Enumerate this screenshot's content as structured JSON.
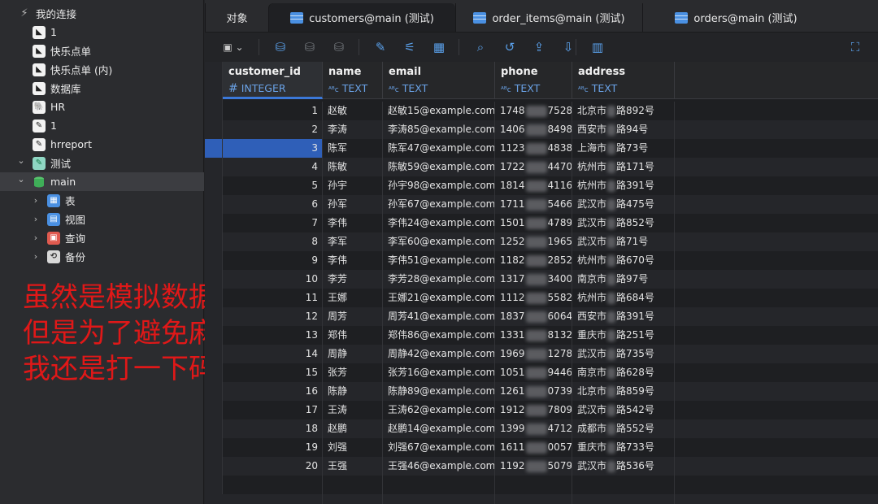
{
  "sidebar": {
    "items": [
      {
        "label": "我的连接",
        "icon": "connections-icon",
        "depth": 0
      },
      {
        "label": "1",
        "icon": "connection-icon",
        "depth": 1
      },
      {
        "label": "快乐点单",
        "icon": "connection-icon",
        "depth": 1
      },
      {
        "label": "快乐点单 (内)",
        "icon": "connection-icon",
        "depth": 1
      },
      {
        "label": "数据库",
        "icon": "connection-icon",
        "depth": 1
      },
      {
        "label": "HR",
        "icon": "postgres-icon",
        "depth": 1
      },
      {
        "label": "1",
        "icon": "feather-icon",
        "depth": 1
      },
      {
        "label": "hrreport",
        "icon": "feather-icon",
        "depth": 1
      },
      {
        "label": "测试",
        "icon": "sqlite-icon",
        "depth": 1,
        "expanded": true
      },
      {
        "label": "main",
        "icon": "database-icon",
        "depth": 2,
        "expanded": true,
        "selected": true
      },
      {
        "label": "表",
        "icon": "table-icon",
        "depth": 3
      },
      {
        "label": "视图",
        "icon": "view-icon",
        "depth": 3
      },
      {
        "label": "查询",
        "icon": "query-icon",
        "depth": 3
      },
      {
        "label": "备份",
        "icon": "backup-icon",
        "depth": 3
      }
    ]
  },
  "annotation": {
    "lines": [
      "虽然是模拟数据，",
      "但是为了避免麻烦，",
      "我还是打一下码"
    ],
    "color": "#e01818"
  },
  "tabs": [
    {
      "label": "对象",
      "active": false
    },
    {
      "label": "customers@main (测试)",
      "active": true
    },
    {
      "label": "order_items@main (测试)",
      "active": false
    },
    {
      "label": "orders@main (测试)",
      "active": false
    }
  ],
  "toolbar": {
    "buttons": [
      "save-icon",
      "db-add-icon",
      "db-delete-icon",
      "db-refresh-icon",
      "edit-icon",
      "filter-icon",
      "table-check-icon",
      "search-icon",
      "undo-icon",
      "export-icon",
      "import-icon",
      "chart-icon",
      "fullscreen-icon"
    ]
  },
  "grid": {
    "columns": [
      {
        "name": "customer_id",
        "type": "INTEGER",
        "type_mark": "#"
      },
      {
        "name": "name",
        "type": "TEXT",
        "type_mark": "ABC"
      },
      {
        "name": "email",
        "type": "TEXT",
        "type_mark": "ABC"
      },
      {
        "name": "phone",
        "type": "TEXT",
        "type_mark": "ABC"
      },
      {
        "name": "address",
        "type": "TEXT",
        "type_mark": "ABC"
      }
    ],
    "selected_row": 3,
    "rows": [
      {
        "id": "1",
        "name": "赵敏",
        "email": "赵敏15@example.com",
        "phone_a": "1748",
        "phone_b": "7528",
        "addr_a": "北京市",
        "addr_b": "路892号"
      },
      {
        "id": "2",
        "name": "李涛",
        "email": "李涛85@example.com",
        "phone_a": "1406",
        "phone_b": "8498",
        "addr_a": "西安市",
        "addr_b": "路94号"
      },
      {
        "id": "3",
        "name": "陈军",
        "email": "陈军47@example.com",
        "phone_a": "1123",
        "phone_b": "4838",
        "addr_a": "上海市",
        "addr_b": "路73号"
      },
      {
        "id": "4",
        "name": "陈敏",
        "email": "陈敏59@example.com",
        "phone_a": "1722",
        "phone_b": "4470",
        "addr_a": "杭州市",
        "addr_b": "路171号"
      },
      {
        "id": "5",
        "name": "孙宇",
        "email": "孙宇98@example.com",
        "phone_a": "1814",
        "phone_b": "4116",
        "addr_a": "杭州市",
        "addr_b": "路391号"
      },
      {
        "id": "6",
        "name": "孙军",
        "email": "孙军67@example.com",
        "phone_a": "1711",
        "phone_b": "5466",
        "addr_a": "武汉市",
        "addr_b": "路475号"
      },
      {
        "id": "7",
        "name": "李伟",
        "email": "李伟24@example.com",
        "phone_a": "1501",
        "phone_b": "4789",
        "addr_a": "武汉市",
        "addr_b": "路852号"
      },
      {
        "id": "8",
        "name": "李军",
        "email": "李军60@example.com",
        "phone_a": "1252",
        "phone_b": "1965",
        "addr_a": "武汉市",
        "addr_b": "路71号"
      },
      {
        "id": "9",
        "name": "李伟",
        "email": "李伟51@example.com",
        "phone_a": "1182",
        "phone_b": "2852",
        "addr_a": "杭州市",
        "addr_b": "路670号"
      },
      {
        "id": "10",
        "name": "李芳",
        "email": "李芳28@example.com",
        "phone_a": "1317",
        "phone_b": "3400",
        "addr_a": "南京市",
        "addr_b": "路97号"
      },
      {
        "id": "11",
        "name": "王娜",
        "email": "王娜21@example.com",
        "phone_a": "1112",
        "phone_b": "5582",
        "addr_a": "杭州市",
        "addr_b": "路684号"
      },
      {
        "id": "12",
        "name": "周芳",
        "email": "周芳41@example.com",
        "phone_a": "1837",
        "phone_b": "6064",
        "addr_a": "西安市",
        "addr_b": "路391号"
      },
      {
        "id": "13",
        "name": "郑伟",
        "email": "郑伟86@example.com",
        "phone_a": "1331",
        "phone_b": "8132",
        "addr_a": "重庆市",
        "addr_b": "路251号"
      },
      {
        "id": "14",
        "name": "周静",
        "email": "周静42@example.com",
        "phone_a": "1969",
        "phone_b": "1278",
        "addr_a": "武汉市",
        "addr_b": "路735号"
      },
      {
        "id": "15",
        "name": "张芳",
        "email": "张芳16@example.com",
        "phone_a": "1051",
        "phone_b": "9446",
        "addr_a": "南京市",
        "addr_b": "路628号"
      },
      {
        "id": "16",
        "name": "陈静",
        "email": "陈静89@example.com",
        "phone_a": "1261",
        "phone_b": "0739",
        "addr_a": "北京市",
        "addr_b": "路859号"
      },
      {
        "id": "17",
        "name": "王涛",
        "email": "王涛62@example.com",
        "phone_a": "1912",
        "phone_b": "7809",
        "addr_a": "武汉市",
        "addr_b": "路542号"
      },
      {
        "id": "18",
        "name": "赵鹏",
        "email": "赵鹏14@example.com",
        "phone_a": "1399",
        "phone_b": "4712",
        "addr_a": "成都市",
        "addr_b": "路552号"
      },
      {
        "id": "19",
        "name": "刘强",
        "email": "刘强67@example.com",
        "phone_a": "1611",
        "phone_b": "0057",
        "addr_a": "重庆市",
        "addr_b": "路733号"
      },
      {
        "id": "20",
        "name": "王强",
        "email": "王强46@example.com",
        "phone_a": "1192",
        "phone_b": "5079",
        "addr_a": "武汉市",
        "addr_b": "路536号"
      }
    ]
  }
}
